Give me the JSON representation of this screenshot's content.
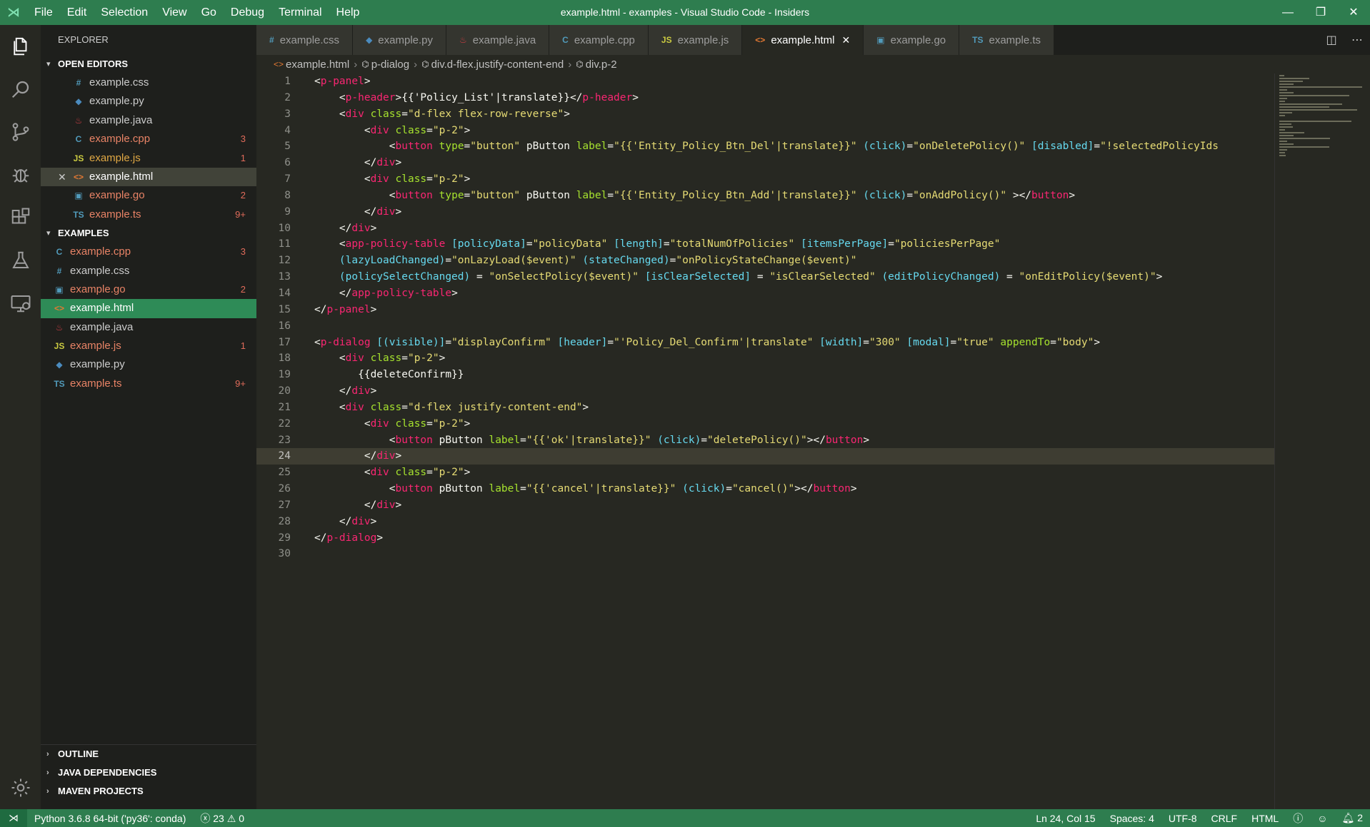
{
  "window": {
    "title": "example.html - examples - Visual Studio Code - Insiders",
    "menu": [
      "File",
      "Edit",
      "Selection",
      "View",
      "Go",
      "Debug",
      "Terminal",
      "Help"
    ]
  },
  "sidebar": {
    "title": "EXPLORER",
    "open_editors": {
      "label": "OPEN EDITORS",
      "files": [
        {
          "name": "example.css",
          "icon": "#",
          "icon_color": "#519aba",
          "state": "normal",
          "badge": ""
        },
        {
          "name": "example.py",
          "icon": "◆",
          "icon_color": "#4b8bbe",
          "state": "normal",
          "badge": ""
        },
        {
          "name": "example.java",
          "icon": "♨",
          "icon_color": "#cc3e44",
          "state": "normal",
          "badge": ""
        },
        {
          "name": "example.cpp",
          "icon": "C",
          "icon_color": "#519aba",
          "state": "err",
          "badge": "3"
        },
        {
          "name": "example.js",
          "icon": "JS",
          "icon_color": "#cbcb41",
          "state": "warn",
          "badge": "1"
        },
        {
          "name": "example.html",
          "icon": "<>",
          "icon_color": "#e37933",
          "state": "sel",
          "badge": ""
        },
        {
          "name": "example.go",
          "icon": "▣",
          "icon_color": "#519aba",
          "state": "err",
          "badge": "2"
        },
        {
          "name": "example.ts",
          "icon": "TS",
          "icon_color": "#519aba",
          "state": "err",
          "badge": "9+"
        }
      ]
    },
    "examples": {
      "label": "EXAMPLES",
      "files": [
        {
          "name": "example.cpp",
          "icon": "C",
          "icon_color": "#519aba",
          "state": "err",
          "badge": "3"
        },
        {
          "name": "example.css",
          "icon": "#",
          "icon_color": "#519aba",
          "state": "normal",
          "badge": ""
        },
        {
          "name": "example.go",
          "icon": "▣",
          "icon_color": "#519aba",
          "state": "err",
          "badge": "2"
        },
        {
          "name": "example.html",
          "icon": "<>",
          "icon_color": "#e37933",
          "state": "active",
          "badge": ""
        },
        {
          "name": "example.java",
          "icon": "♨",
          "icon_color": "#cc3e44",
          "state": "normal",
          "badge": ""
        },
        {
          "name": "example.js",
          "icon": "JS",
          "icon_color": "#cbcb41",
          "state": "err",
          "badge": "1"
        },
        {
          "name": "example.py",
          "icon": "◆",
          "icon_color": "#4b8bbe",
          "state": "normal",
          "badge": ""
        },
        {
          "name": "example.ts",
          "icon": "TS",
          "icon_color": "#519aba",
          "state": "err",
          "badge": "9+"
        }
      ]
    },
    "bottom_sections": [
      "OUTLINE",
      "JAVA DEPENDENCIES",
      "MAVEN PROJECTS"
    ]
  },
  "tabs": [
    {
      "label": "example.css",
      "icon": "#",
      "icon_color": "#519aba",
      "active": false
    },
    {
      "label": "example.py",
      "icon": "◆",
      "icon_color": "#4b8bbe",
      "active": false
    },
    {
      "label": "example.java",
      "icon": "♨",
      "icon_color": "#cc3e44",
      "active": false
    },
    {
      "label": "example.cpp",
      "icon": "C",
      "icon_color": "#519aba",
      "active": false
    },
    {
      "label": "example.js",
      "icon": "JS",
      "icon_color": "#cbcb41",
      "active": false
    },
    {
      "label": "example.html",
      "icon": "<>",
      "icon_color": "#e37933",
      "active": true
    },
    {
      "label": "example.go",
      "icon": "▣",
      "icon_color": "#519aba",
      "active": false
    },
    {
      "label": "example.ts",
      "icon": "TS",
      "icon_color": "#519aba",
      "active": false
    }
  ],
  "breadcrumb": [
    "example.html",
    "p-dialog",
    "div.d-flex.justify-content-end",
    "div.p-2"
  ],
  "editor": {
    "current_line": 24,
    "lines": [
      "<p-panel>",
      "    <p-header>{{'Policy_List'|translate}}</p-header>",
      "    <div class=\"d-flex flex-row-reverse\">",
      "        <div class=\"p-2\">",
      "            <button type=\"button\" pButton label=\"{{'Entity_Policy_Btn_Del'|translate}}\" (click)=\"onDeletePolicy()\" [disabled]=\"!selectedPolicyIds",
      "        </div>",
      "        <div class=\"p-2\">",
      "            <button type=\"button\" pButton label=\"{{'Entity_Policy_Btn_Add'|translate}}\" (click)=\"onAddPolicy()\" ></button>",
      "        </div>",
      "    </div>",
      "    <app-policy-table [policyData]=\"policyData\" [length]=\"totalNumOfPolicies\" [itemsPerPage]=\"policiesPerPage\"",
      "    (lazyLoadChanged)=\"onLazyLoad($event)\" (stateChanged)=\"onPolicyStateChange($event)\"",
      "    (policySelectChanged) = \"onSelectPolicy($event)\" [isClearSelected] = \"isClearSelected\" (editPolicyChanged) = \"onEditPolicy($event)\">",
      "    </app-policy-table>",
      "</p-panel>",
      "",
      "<p-dialog [(visible)]=\"displayConfirm\" [header]=\"'Policy_Del_Confirm'|translate\" [width]=\"300\" [modal]=\"true\" appendTo=\"body\">",
      "    <div class=\"p-2\">",
      "       {{deleteConfirm}}",
      "    </div>",
      "    <div class=\"d-flex justify-content-end\">",
      "        <div class=\"p-2\">",
      "            <button pButton label=\"{{'ok'|translate}}\" (click)=\"deletePolicy()\"></button>",
      "        </div>",
      "        <div class=\"p-2\">",
      "            <button pButton label=\"{{'cancel'|translate}}\" (click)=\"cancel()\"></button>",
      "        </div>",
      "    </div>",
      "</p-dialog>",
      ""
    ]
  },
  "statusbar": {
    "python": "Python 3.6.8 64-bit ('py36': conda)",
    "errors": "23",
    "warnings": "0",
    "position": "Ln 24, Col 15",
    "spaces": "Spaces: 4",
    "encoding": "UTF-8",
    "eol": "CRLF",
    "language": "HTML",
    "notifications": "2"
  },
  "colors": {
    "accent": "#2e7d4f",
    "active_item": "#2e8b57",
    "editor_bg": "#272822"
  }
}
